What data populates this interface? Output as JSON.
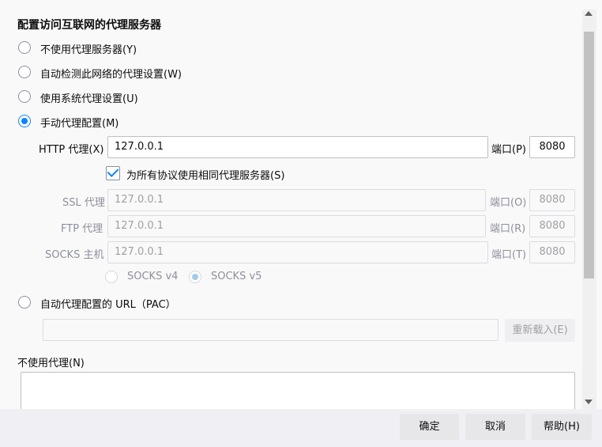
{
  "title": "配置访问互联网的代理服务器",
  "options": {
    "no_proxy": "不使用代理服务器(Y)",
    "auto_detect": "自动检测此网络的代理设置(W)",
    "system": "使用系统代理设置(U)",
    "manual": "手动代理配置(M)",
    "pac": "自动代理配置的 URL（PAC）"
  },
  "manual": {
    "http_label": "HTTP 代理(X)",
    "http_value": "127.0.0.1",
    "port_label": "端口(P)",
    "http_port": "8080",
    "same_proxy_label": "为所有协议使用相同代理服务器(S)",
    "ssl_label": "SSL 代理",
    "ssl_value": "127.0.0.1",
    "ssl_port_label": "端口(O)",
    "ssl_port": "8080",
    "ftp_label": "FTP 代理",
    "ftp_value": "127.0.0.1",
    "ftp_port_label": "端口(R)",
    "ftp_port": "8080",
    "socks_label": "SOCKS 主机",
    "socks_value": "127.0.0.1",
    "socks_port_label": "端口(T)",
    "socks_port": "8080",
    "socks_v4": "SOCKS v4",
    "socks_v5": "SOCKS v5"
  },
  "pac": {
    "url_value": "",
    "reload_label": "重新载入(E)"
  },
  "no_proxy_for": {
    "label": "不使用代理(N)",
    "value": ""
  },
  "buttons": {
    "ok": "确定",
    "cancel": "取消",
    "help": "帮助(H)"
  },
  "colors": {
    "accent": "#0a84ff"
  }
}
